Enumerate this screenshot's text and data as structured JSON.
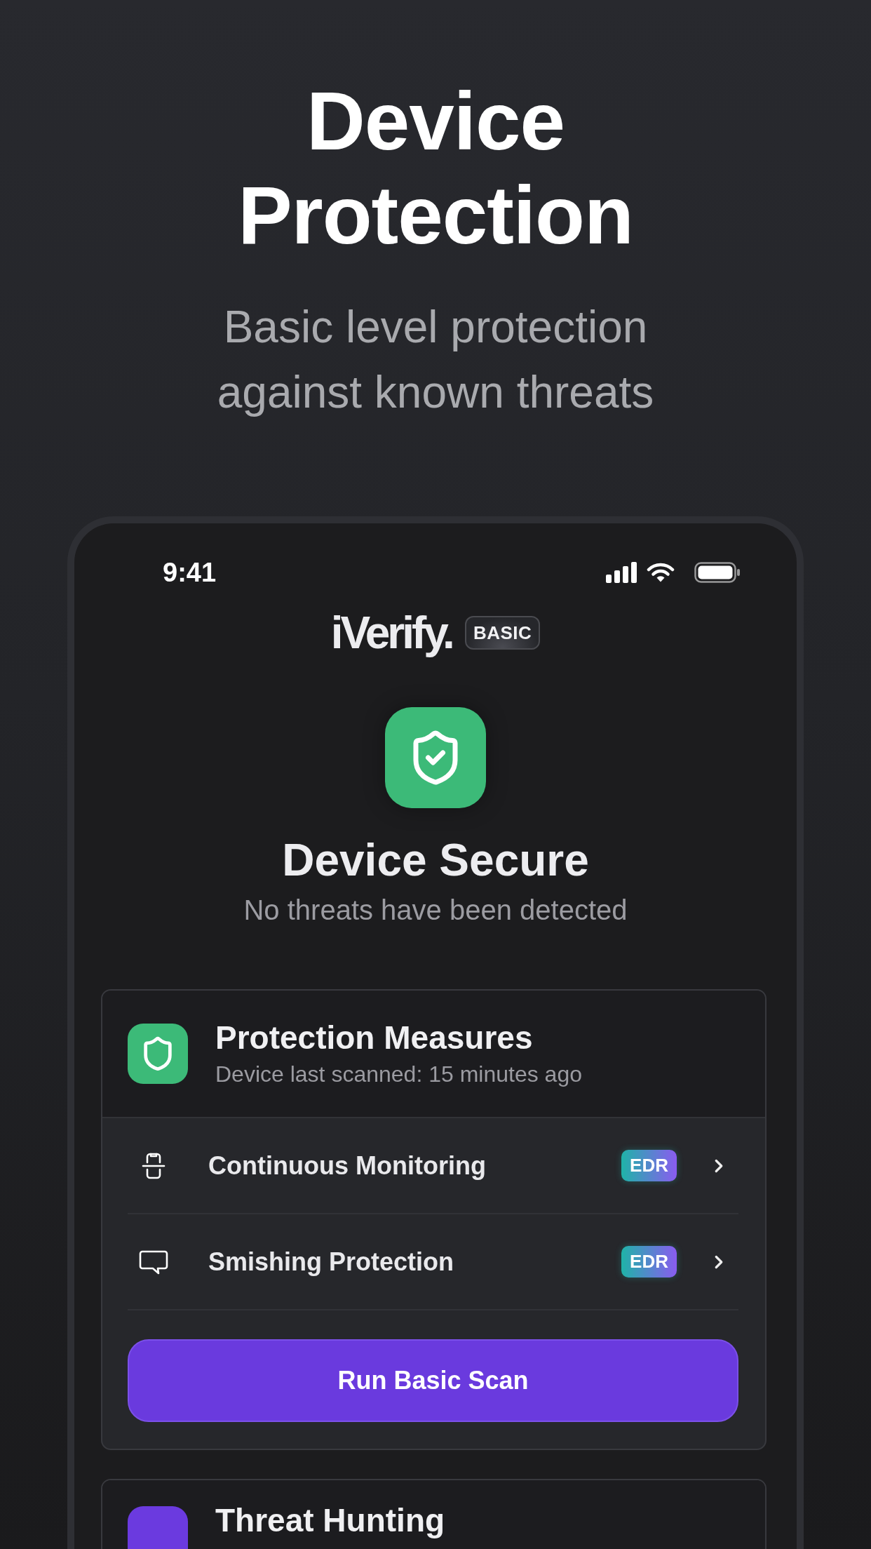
{
  "hero": {
    "title": "Device Protection",
    "subtitle": "Basic level protection against known threats"
  },
  "phone": {
    "status_bar": {
      "time": "9:41"
    },
    "app": {
      "logo": "iVerify.",
      "plan_badge": "BASIC",
      "status": {
        "title": "Device Secure",
        "subtitle": "No threats have been detected"
      },
      "cards": [
        {
          "title": "Protection Measures",
          "subtitle": "Device last scanned: 15 minutes ago",
          "color": "#3cba78",
          "items": [
            {
              "label": "Continuous Monitoring",
              "badge": "EDR",
              "kind": "monitoring"
            },
            {
              "label": "Smishing Protection",
              "badge": "EDR",
              "kind": "messages"
            }
          ],
          "button": "Run Basic Scan"
        },
        {
          "title": "Threat Hunting",
          "color": "#6b3adf"
        }
      ]
    }
  }
}
